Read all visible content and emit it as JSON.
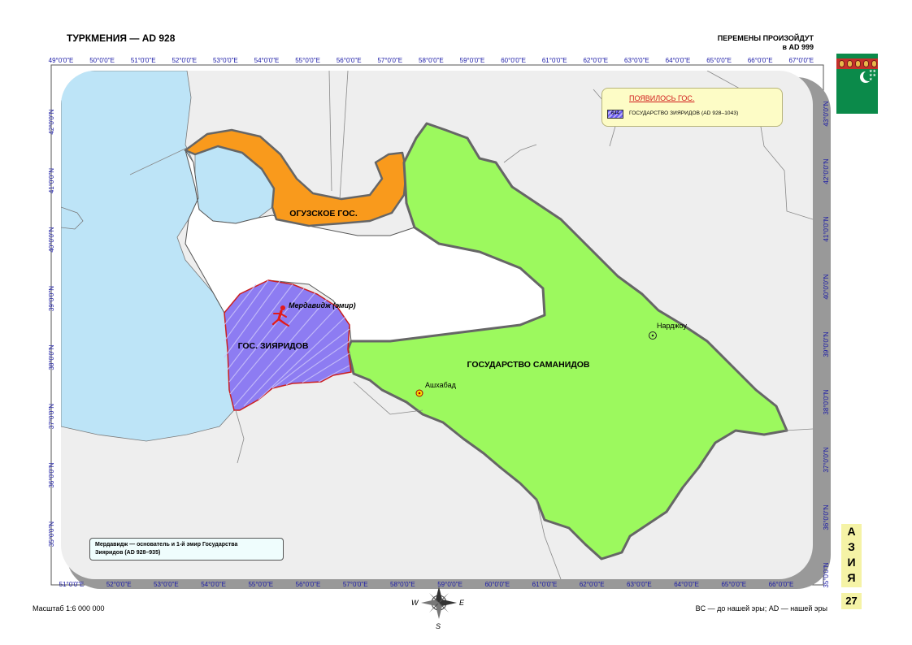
{
  "header": {
    "title": "ТУРКМЕНИЯ — AD 928",
    "changes_line1": "ПЕРЕМЕНЫ ПРОИЗОЙДУТ",
    "changes_line2": "в AD 999"
  },
  "flag": {
    "icon": "turkmenistan-flag-icon",
    "field_color": "#0b8a4a",
    "stripe_color": "#c4302b"
  },
  "axes": {
    "top_lon": [
      "49°0'0\"E",
      "50°0'0\"E",
      "51°0'0\"E",
      "52°0'0\"E",
      "53°0'0\"E",
      "54°0'0\"E",
      "55°0'0\"E",
      "56°0'0\"E",
      "57°0'0\"E",
      "58°0'0\"E",
      "59°0'0\"E",
      "60°0'0\"E",
      "61°0'0\"E",
      "62°0'0\"E",
      "63°0'0\"E",
      "64°0'0\"E",
      "65°0'0\"E",
      "66°0'0\"E",
      "67°0'0\"E"
    ],
    "bottom_lon": [
      "51°0'0\"E",
      "52°0'0\"E",
      "53°0'0\"E",
      "54°0'0\"E",
      "55°0'0\"E",
      "56°0'0\"E",
      "57°0'0\"E",
      "58°0'0\"E",
      "59°0'0\"E",
      "60°0'0\"E",
      "61°0'0\"E",
      "62°0'0\"E",
      "63°0'0\"E",
      "64°0'0\"E",
      "65°0'0\"E",
      "66°0'0\"E"
    ],
    "left_lat": [
      "42°0'0\"N",
      "41°0'0\"N",
      "40°0'0\"N",
      "39°0'0\"N",
      "38°0'0\"N",
      "37°0'0\"N",
      "36°0'0\"N",
      "35°0'0\"N"
    ],
    "right_lat": [
      "43°0'0\"N",
      "42°0'0\"N",
      "41°0'0\"N",
      "40°0'0\"N",
      "39°0'0\"N",
      "38°0'0\"N",
      "37°0'0\"N",
      "36°0'0\"N",
      "35°0'0\"N"
    ]
  },
  "regions": {
    "oguz": {
      "label": "ОГУЗСКОЕ ГОС.",
      "color": "#f99a1c"
    },
    "ziyarid": {
      "label": "ГОС. ЗИЯРИДОВ",
      "color": "#8d7cf2"
    },
    "samanid": {
      "label": "ГОСУДАРСТВО САМАНИДОВ",
      "color": "#9cf95e"
    },
    "sea_color": "#bde4f7",
    "land_color": "#eeeeee"
  },
  "cities": {
    "ashgabat": "Ашхабад",
    "nardzhou": "Нарджоу"
  },
  "event": {
    "label": "Мердавидж (эмир)",
    "icon": "running-man-icon"
  },
  "legend": {
    "title": "ПОЯВИЛОСЬ ГОС.",
    "swatch_code": "644",
    "item": "ГОСУДАРСТВО ЗИЯРИДОВ (AD 928–1043)"
  },
  "note": {
    "line1": "Мердавидж — основатель и 1-й эмир Государства",
    "line2": "Зияридов (AD 928–935)"
  },
  "compass": {
    "icon": "compass-rose-icon",
    "west": "W",
    "east": "E",
    "south": "S"
  },
  "footer": {
    "scale": "Масштаб 1:6 000 000",
    "era_note": "BC — до нашей эры; AD — нашей эры"
  },
  "side_tab": {
    "letters": [
      "А",
      "З",
      "И",
      "Я"
    ],
    "page": "27"
  }
}
